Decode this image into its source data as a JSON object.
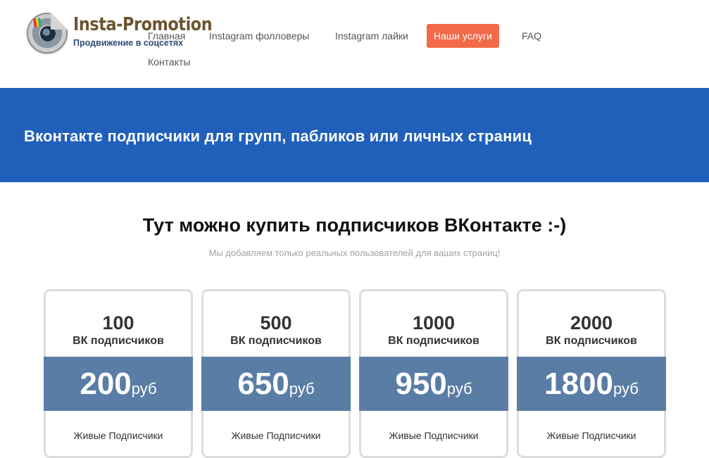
{
  "logo": {
    "title": "Insta-Promotion",
    "subtitle": "Продвижение в соцсетях"
  },
  "nav": {
    "items": [
      {
        "label": "Главная"
      },
      {
        "label": "Instagram фолловеры"
      },
      {
        "label": "Instagram лайки"
      },
      {
        "label": "Наши услуги"
      },
      {
        "label": "FAQ"
      },
      {
        "label": "Контакты"
      }
    ],
    "active_index": 3
  },
  "banner": {
    "title": "Вконтакте подписчики для групп, пабликов или личных страниц"
  },
  "main": {
    "title": "Тут можно купить подписчиков ВКонтакте :-)",
    "subtitle": "Мы добавляем только реальных пользователей для ваших страниц!"
  },
  "pricing": [
    {
      "qty": "100",
      "unit": "ВК подписчиков",
      "price": "200",
      "currency": "руб",
      "feature": "Живые Подписчики"
    },
    {
      "qty": "500",
      "unit": "ВК подписчиков",
      "price": "650",
      "currency": "руб",
      "feature": "Живые Подписчики"
    },
    {
      "qty": "1000",
      "unit": "ВК подписчиков",
      "price": "950",
      "currency": "руб",
      "feature": "Живые Подписчики"
    },
    {
      "qty": "2000",
      "unit": "ВК подписчиков",
      "price": "1800",
      "currency": "руб",
      "feature": "Живые Подписчики"
    }
  ],
  "colors": {
    "banner": "#2060bb",
    "active_nav": "#f26a48",
    "price_band": "#5a7da5"
  }
}
